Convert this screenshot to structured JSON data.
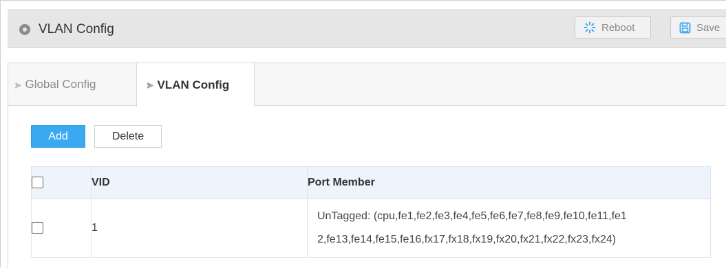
{
  "header": {
    "title": "VLAN Config",
    "reboot_label": "Reboot",
    "save_label": "Save"
  },
  "tabs": [
    {
      "label": "Global Config",
      "active": false
    },
    {
      "label": "VLAN Config",
      "active": true
    }
  ],
  "toolbar": {
    "add_label": "Add",
    "delete_label": "Delete"
  },
  "table": {
    "columns": [
      "",
      "VID",
      "Port Member"
    ],
    "rows": [
      {
        "checked": false,
        "vid": "1",
        "port_member_line1": "UnTagged: (cpu,fe1,fe2,fe3,fe4,fe5,fe6,fe7,fe8,fe9,fe10,fe11,fe1",
        "port_member_line2": "2,fe13,fe14,fe15,fe16,fx17,fx18,fx19,fx20,fx21,fx22,fx23,fx24)"
      }
    ]
  },
  "colors": {
    "accent": "#3aa9f2",
    "header_bg": "#e6e6e6",
    "table_header_bg": "#edf4fb"
  },
  "icons": {
    "header": "circle-icon",
    "reboot": "spinner-icon",
    "save": "floppy-disk-icon",
    "tab": "chevron-right-icon"
  }
}
